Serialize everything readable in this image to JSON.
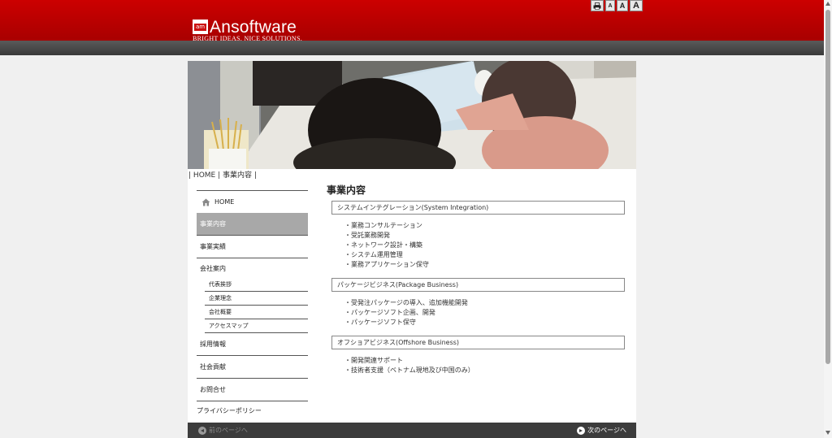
{
  "brand": {
    "logo_mark_text": "am",
    "name": "Ansoftware",
    "tagline": "BRIGHT IDEAS. NICE SOLUTIONS."
  },
  "tools": {
    "print_icon": "printer-icon",
    "font_small": "A",
    "font_medium": "A",
    "font_large": "A"
  },
  "breadcrumb": {
    "sep_left": "|",
    "home": "HOME",
    "sep_mid": "|",
    "current": "事業内容",
    "sep_right": "|"
  },
  "sidebar": {
    "home": "HOME",
    "items": [
      "事業内容",
      "事業実績",
      "会社案内"
    ],
    "sub_items": [
      "代表挨拶",
      "企業理念",
      "会社概要",
      "アクセスマップ"
    ],
    "after_items": [
      "採用情報",
      "社会貢献",
      "お問合せ"
    ],
    "last": "プライバシーポリシー",
    "active_index": 0
  },
  "main": {
    "title": "事業内容",
    "sections": [
      {
        "heading": "システムインテグレーション(System Integration)",
        "items": [
          "・業務コンサルテーション",
          "・受託業務開発",
          "・ネットワーク設計・構築",
          "・システム運用管理",
          "・業務アプリケーション保守"
        ]
      },
      {
        "heading": "パッケージビジネス(Package Business)",
        "items": [
          "・受発注パッケージの導入、追加機能開発",
          "・パッケージソフト企画、開発",
          "・パッケージソフト保守"
        ]
      },
      {
        "heading": "オフショアビジネス(Offshore Business)",
        "items": [
          "・開発関連サポート",
          "・技術者支援（ベトナム現地及び中国のみ）"
        ]
      }
    ]
  },
  "footer": {
    "prev": "前のページへ",
    "next": "次のページへ"
  },
  "colors": {
    "header_red": "#cc0000",
    "band_gray": "#444444",
    "active_nav": "#a8a8a8",
    "footer_dark": "#3c3c3c"
  }
}
